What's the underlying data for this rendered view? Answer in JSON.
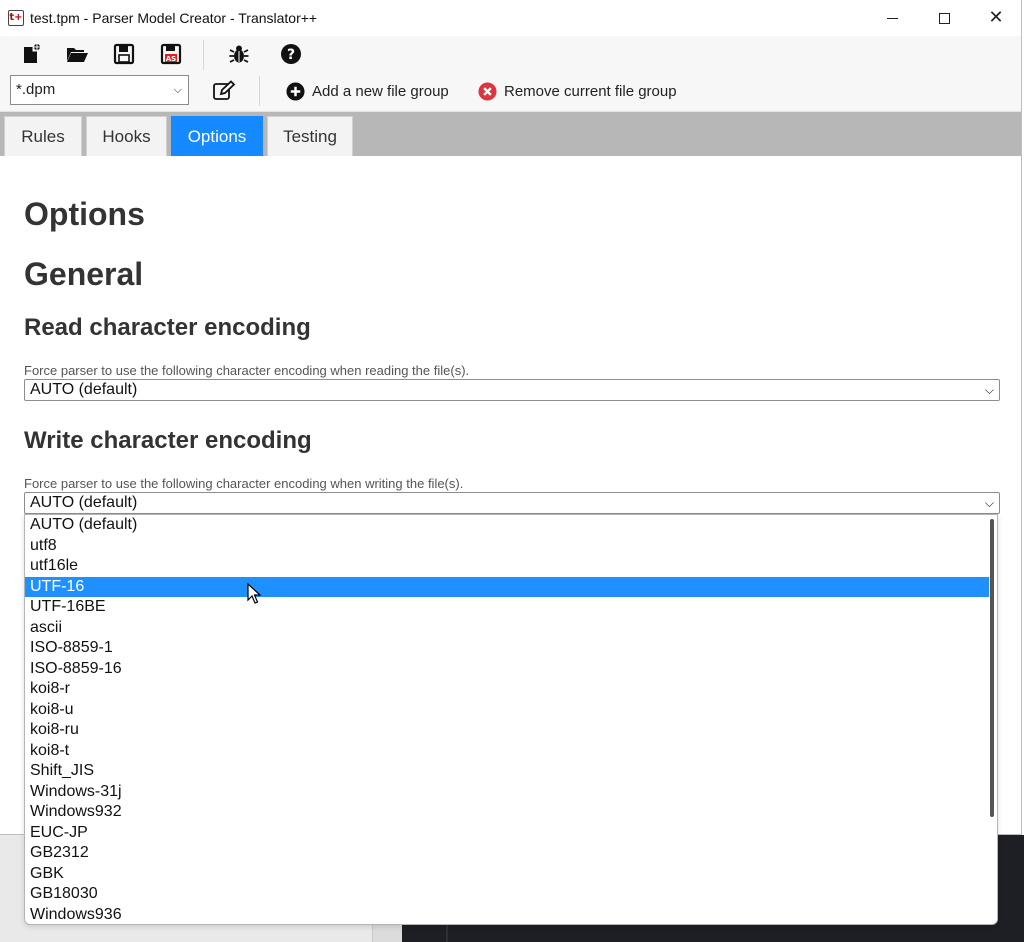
{
  "window": {
    "title": "test.tpm - Parser Model Creator - Translator++",
    "app_icon_text": "t+",
    "minimize_symbol": "—",
    "maximize_symbol": "☐",
    "close_symbol": "✕"
  },
  "toolbar1": {
    "icons": [
      "new-file-icon",
      "open-folder-icon",
      "save-icon",
      "save-as-icon",
      "bug-icon",
      "help-icon"
    ],
    "save_as_badge": "AS",
    "help_glyph": "?"
  },
  "toolbar2": {
    "file_filter_value": "*.dpm",
    "add_group_label": "Add a new file group",
    "remove_group_label": "Remove current file group"
  },
  "tabs": [
    {
      "label": "Rules",
      "active": false
    },
    {
      "label": "Hooks",
      "active": false
    },
    {
      "label": "Options",
      "active": true
    },
    {
      "label": "Testing",
      "active": false
    }
  ],
  "content": {
    "heading": "Options",
    "section": "General",
    "read_title": "Read character encoding",
    "read_hint": "Force parser to use the following character encoding when reading the file(s).",
    "read_value": "AUTO (default)",
    "write_title": "Write character encoding",
    "write_hint": "Force parser to use the following character encoding when writing the file(s).",
    "write_value": "AUTO (default)"
  },
  "dropdown": {
    "options": [
      "AUTO (default)",
      "utf8",
      "utf16le",
      "UTF-16",
      "UTF-16BE",
      "ascii",
      "ISO-8859-1",
      "ISO-8859-16",
      "koi8-r",
      "koi8-u",
      "koi8-ru",
      "koi8-t",
      "Shift_JIS",
      "Windows-31j",
      "Windows932",
      "EUC-JP",
      "GB2312",
      "GBK",
      "GB18030",
      "Windows936"
    ],
    "highlighted": "UTF-16"
  },
  "colors": {
    "accent": "#1589ff",
    "selection": "#1e90ff",
    "add_icon": "#111111",
    "remove_icon": "#d9363e"
  }
}
